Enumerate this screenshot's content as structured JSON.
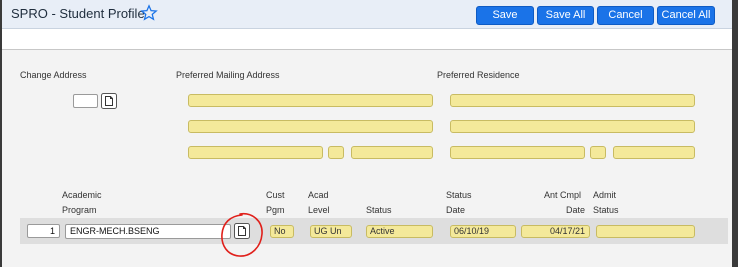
{
  "window": {
    "title": "SPRO - Student Profile",
    "buttons": {
      "save": "Save",
      "save_all": "Save All",
      "cancel": "Cancel",
      "cancel_all": "Cancel All"
    }
  },
  "address": {
    "change_address_label": "Change Address",
    "preferred_mailing_label": "Preferred Mailing Address",
    "preferred_residence_label": "Preferred Residence",
    "change_address_value": ""
  },
  "program": {
    "headers": {
      "academic_program_line1": "Academic",
      "academic_program_line2": "Program",
      "cust_pgm_line1": "Cust",
      "cust_pgm_line2": "Pgm",
      "acad_level_line1": "Acad",
      "acad_level_line2": "Level",
      "status": "Status",
      "status_date_line1": "Status",
      "status_date_line2": "Date",
      "ant_cmpl_date_line1": "Ant Cmpl",
      "ant_cmpl_date_line2": "Date",
      "admit_status_line1": "Admit",
      "admit_status_line2": "Status"
    },
    "row": {
      "row_number": "1",
      "academic_program": "ENGR-MECH.BSENG",
      "cust_pgm": "No",
      "acad_level": "UG Un",
      "status": "Active",
      "status_date": "06/10/19",
      "ant_cmpl_date": "04/17/21",
      "admit_status": ""
    }
  },
  "colors": {
    "button_blue": "#1a73e8",
    "field_yellow": "#f4e99a",
    "annotation_red": "#e0201b"
  },
  "icons": {
    "favorite": "star-outline-icon",
    "detail": "document-icon"
  }
}
